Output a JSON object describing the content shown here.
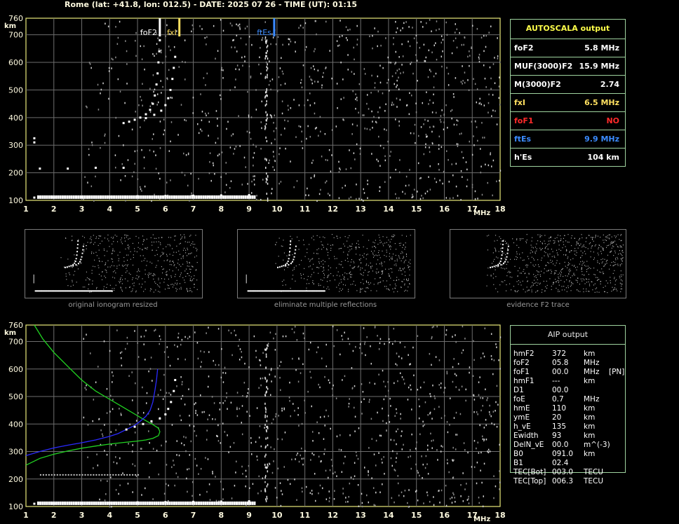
{
  "header": "Rome (lat: +41.8, lon: 012.5) - DATE: 2025 07 26 - TIME (UT): 01:15",
  "autoscala": {
    "title": "AUTOSCALA output",
    "rows": [
      {
        "label": "foF2",
        "value": "5.8 MHz",
        "color": "#ffffff"
      },
      {
        "label": "MUF(3000)F2",
        "value": "15.9 MHz",
        "color": "#ffffff"
      },
      {
        "label": "M(3000)F2",
        "value": "2.74",
        "color": "#ffffff"
      },
      {
        "label": "fxI",
        "value": "6.5 MHz",
        "color": "#ffe060"
      },
      {
        "label": "foF1",
        "value": "NO",
        "color": "#ff2a2a"
      },
      {
        "label": "ftEs",
        "value": "9.9 MHz",
        "color": "#3b8bff"
      },
      {
        "label": "h'Es",
        "value": "104    km",
        "color": "#ffffff"
      }
    ]
  },
  "thumbnails": {
    "captions": [
      "original ionogram resized",
      "eliminate multiple reflections",
      "evidence F2 trace"
    ]
  },
  "aip": {
    "title": "AIP output",
    "rows": [
      {
        "name": "hmF2",
        "value": "372",
        "unit": "km",
        "extra": ""
      },
      {
        "name": "foF2",
        "value": "05.8",
        "unit": "MHz",
        "extra": ""
      },
      {
        "name": "foF1",
        "value": "00.0",
        "unit": "MHz",
        "extra": "[PN]"
      },
      {
        "name": "hmF1",
        "value": "---",
        "unit": "km",
        "extra": ""
      },
      {
        "name": "D1",
        "value": "00.0",
        "unit": "",
        "extra": ""
      },
      {
        "name": "foE",
        "value": "0.7",
        "unit": "MHz",
        "extra": ""
      },
      {
        "name": "hmE",
        "value": "110",
        "unit": "km",
        "extra": ""
      },
      {
        "name": "ymE",
        "value": "20",
        "unit": "km",
        "extra": ""
      },
      {
        "name": "h_vE",
        "value": "135",
        "unit": "km",
        "extra": ""
      },
      {
        "name": "Ewidth",
        "value": "93",
        "unit": "km",
        "extra": ""
      },
      {
        "name": "DelN_vE",
        "value": "00.0",
        "unit": "m^(-3)",
        "extra": ""
      },
      {
        "name": "B0",
        "value": "091.0",
        "unit": "km",
        "extra": ""
      },
      {
        "name": "B1",
        "value": "02.4",
        "unit": "",
        "extra": ""
      },
      {
        "name": "TEC[Bot]",
        "value": "003.0",
        "unit": "TECU",
        "extra": ""
      },
      {
        "name": "TEC[Top]",
        "value": "006.3",
        "unit": "TECU",
        "extra": ""
      }
    ]
  },
  "chart_data": [
    {
      "type": "scatter",
      "title": "",
      "xlabel": "MHz",
      "ylabel": "km",
      "xlim": [
        1,
        18
      ],
      "ylim": [
        100,
        760
      ],
      "xticks": [
        1,
        2,
        3,
        4,
        5,
        6,
        7,
        8,
        9,
        10,
        11,
        12,
        13,
        14,
        15,
        16,
        17,
        18
      ],
      "yticks": [
        100,
        200,
        300,
        400,
        500,
        600,
        700,
        760
      ],
      "grid": true,
      "markers": [
        {
          "name": "foF2",
          "x": 5.8,
          "color": "#ffffff"
        },
        {
          "name": "fxI",
          "x": 6.5,
          "color": "#ffe060"
        },
        {
          "name": "ftEs",
          "x": 9.9,
          "color": "#3b8bff"
        }
      ],
      "series": [
        {
          "color": "#ffffff",
          "points": [
            [
              4.5,
              380
            ],
            [
              4.7,
              385
            ],
            [
              4.9,
              392
            ],
            [
              5.1,
              400
            ],
            [
              5.3,
              412
            ],
            [
              5.45,
              428
            ],
            [
              5.55,
              450
            ],
            [
              5.62,
              480
            ],
            [
              5.68,
              520
            ],
            [
              5.72,
              560
            ],
            [
              5.75,
              600
            ],
            [
              5.78,
              640
            ],
            [
              5.8,
              680
            ],
            [
              5.3,
              398
            ],
            [
              5.6,
              410
            ],
            [
              5.85,
              425
            ],
            [
              6.0,
              445
            ],
            [
              6.1,
              470
            ],
            [
              6.18,
              500
            ],
            [
              6.25,
              540
            ],
            [
              6.3,
              580
            ],
            [
              6.35,
              620
            ]
          ]
        },
        {
          "color": "#ffffff",
          "points": [
            [
              1.3,
              110
            ],
            [
              2,
              110
            ],
            [
              3,
              112
            ],
            [
              4,
              113
            ],
            [
              5,
              115
            ],
            [
              6,
              116
            ],
            [
              7,
              117
            ],
            [
              8,
              118
            ],
            [
              9,
              119
            ],
            [
              1.5,
              215
            ],
            [
              2.5,
              215
            ],
            [
              3.5,
              218
            ],
            [
              4.5,
              218
            ],
            [
              1.3,
              310
            ],
            [
              1.3,
              325
            ]
          ]
        }
      ]
    },
    {
      "type": "line",
      "title": "",
      "xlabel": "MHz",
      "ylabel": "km",
      "xlim": [
        1,
        18
      ],
      "ylim": [
        100,
        760
      ],
      "xticks": [
        1,
        2,
        3,
        4,
        5,
        6,
        7,
        8,
        9,
        10,
        11,
        12,
        13,
        14,
        15,
        16,
        17,
        18
      ],
      "yticks": [
        100,
        200,
        300,
        400,
        500,
        600,
        700,
        760
      ],
      "grid": true,
      "series": [
        {
          "color": "#21d421",
          "x": [
            1.3,
            1.6,
            2.0,
            2.5,
            3.0,
            3.5,
            4.0,
            4.5,
            5.0,
            5.3,
            5.55,
            5.75,
            5.8,
            5.75,
            5.55,
            5.3,
            5.0,
            4.5,
            4.0,
            3.5,
            3.0,
            2.5,
            2.0,
            1.5,
            1.0
          ],
          "y": [
            760,
            710,
            660,
            610,
            560,
            520,
            490,
            460,
            430,
            412,
            398,
            385,
            372,
            358,
            348,
            342,
            338,
            333,
            327,
            320,
            312,
            302,
            290,
            275,
            250
          ]
        },
        {
          "color": "#2a2aff",
          "x": [
            1.0,
            1.5,
            2.0,
            2.5,
            3.0,
            3.5,
            4.0,
            4.3,
            4.6,
            4.9,
            5.1,
            5.3,
            5.45,
            5.55,
            5.62,
            5.68,
            5.72
          ],
          "y": [
            285,
            300,
            313,
            323,
            332,
            342,
            355,
            365,
            380,
            395,
            410,
            428,
            450,
            480,
            520,
            560,
            600
          ]
        },
        {
          "color": "#ffffff",
          "x": [
            4.6,
            4.9,
            5.2,
            5.5,
            5.8,
            6.0,
            6.1,
            6.2,
            6.3,
            6.35
          ],
          "y": [
            380,
            390,
            400,
            410,
            420,
            435,
            455,
            480,
            520,
            560
          ]
        },
        {
          "color": "#ffffff",
          "x": [
            1.3,
            2,
            3,
            4,
            5,
            6,
            7,
            8,
            9
          ],
          "y": [
            110,
            110,
            112,
            113,
            115,
            116,
            117,
            118,
            119
          ]
        }
      ]
    }
  ]
}
